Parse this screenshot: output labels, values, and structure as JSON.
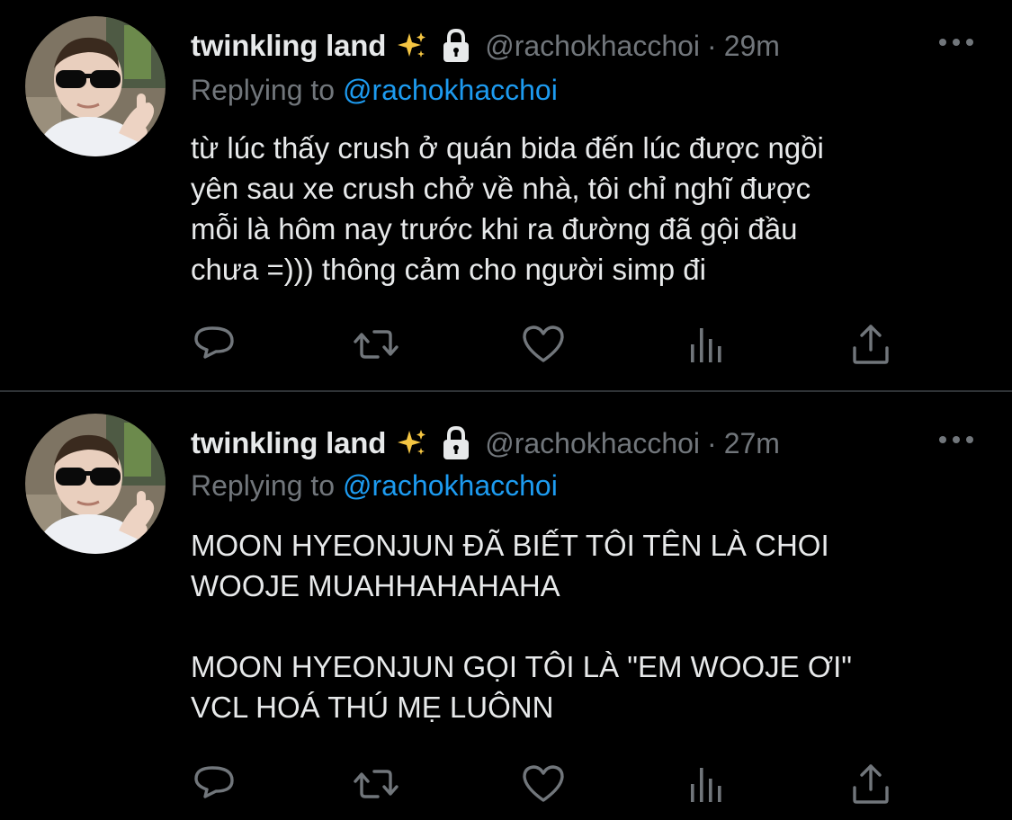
{
  "tweets": [
    {
      "display_name": "twinkling land",
      "handle": "@rachokhacchoi",
      "separator": "·",
      "time": "29m",
      "replying_prefix": "Replying to ",
      "replying_to": "@rachokhacchoi",
      "text": "từ lúc thấy crush ở quán bida đến lúc được ngồi\nyên sau xe crush chở về nhà, tôi chỉ nghĩ được\nmỗi là hôm nay trước khi ra đường đã gội đầu\nchưa =))) thông cảm cho người simp đi"
    },
    {
      "display_name": "twinkling land",
      "handle": "@rachokhacchoi",
      "separator": "·",
      "time": "27m",
      "replying_prefix": "Replying to ",
      "replying_to": "@rachokhacchoi",
      "text": "MOON HYEONJUN ĐÃ BIẾT TÔI TÊN LÀ CHOI\nWOOJE MUAHHAHAHAHA\n\nMOON HYEONJUN GỌI TÔI LÀ \"EM WOOJE ƠI\"\nVCL HOÁ THÚ MẸ LUÔNN"
    }
  ],
  "icons": {
    "sparkle": "sparkles-icon",
    "lock": "lock-icon",
    "more": "more-dots-icon",
    "reply": "reply-icon",
    "retweet": "retweet-icon",
    "like": "heart-icon",
    "analytics": "analytics-icon",
    "share": "share-icon"
  },
  "colors": {
    "background": "#000000",
    "text": "#e7e9ea",
    "muted": "#71767b",
    "link": "#1d9bf0",
    "divider": "#2f3336"
  }
}
